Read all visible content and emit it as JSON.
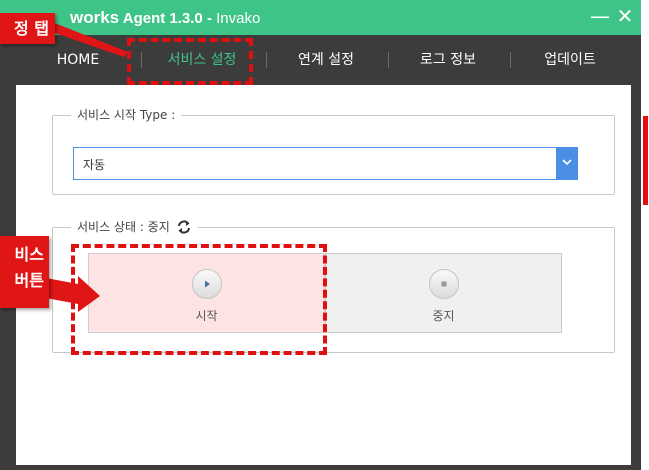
{
  "window": {
    "title_brand": "works",
    "title_rest": " Agent 1.3.0 - ",
    "title_product": "Invako",
    "minimize_glyph": "—",
    "close_glyph": "✕",
    "accent_color": "#3fc488"
  },
  "tabs": [
    {
      "label": "HOME",
      "active": false
    },
    {
      "label": "서비스 설정",
      "active": true
    },
    {
      "label": "연계 설정",
      "active": false
    },
    {
      "label": "로그 정보",
      "active": false
    },
    {
      "label": "업데이트",
      "active": false
    }
  ],
  "service_type": {
    "legend": "서비스 시작 Type :",
    "selected": "자동",
    "arrow_icon": "chevron-down-icon"
  },
  "service_status": {
    "legend": "서비스 상태 : 중지",
    "refresh_icon": "refresh-icon",
    "start_label": "시작",
    "stop_label": "중지"
  },
  "annotations": {
    "tab_callout": "정 탭",
    "service_callout_line1": "비스",
    "service_callout_line2": "버튼",
    "color": "#e01010"
  }
}
